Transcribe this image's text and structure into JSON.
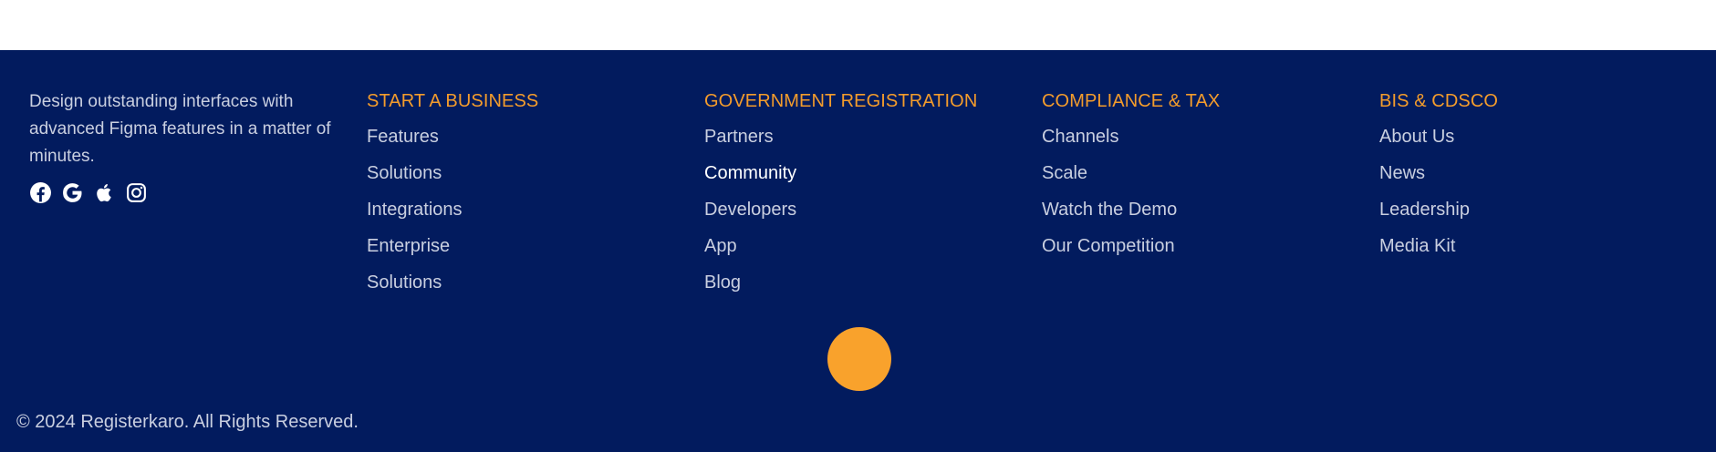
{
  "about": {
    "text": "Design outstanding interfaces with advanced Figma features in a matter of minutes."
  },
  "socials": [
    {
      "icon": "facebook-icon"
    },
    {
      "icon": "google-icon"
    },
    {
      "icon": "apple-icon"
    },
    {
      "icon": "instagram-icon"
    }
  ],
  "columns": [
    {
      "heading": "START A BUSINESS",
      "links": [
        "Features",
        "Solutions",
        "Integrations",
        "Enterprise",
        "Solutions"
      ]
    },
    {
      "heading": "GOVERNMENT REGISTRATION",
      "links": [
        "Partners",
        "Community",
        "Developers",
        "App",
        "Blog"
      ]
    },
    {
      "heading": "COMPLIANCE & TAX",
      "links": [
        "Channels",
        "Scale",
        "Watch the Demo",
        "Our Competition"
      ]
    },
    {
      "heading": "BIS & CDSCO",
      "links": [
        "About Us",
        "News",
        "Leadership",
        "Media Kit"
      ]
    }
  ],
  "copyright": "© 2024 Registerkaro. All Rights Reserved.",
  "colors": {
    "background": "#021b5e",
    "accent": "#f39c2c",
    "link": "#c9cfe0"
  }
}
